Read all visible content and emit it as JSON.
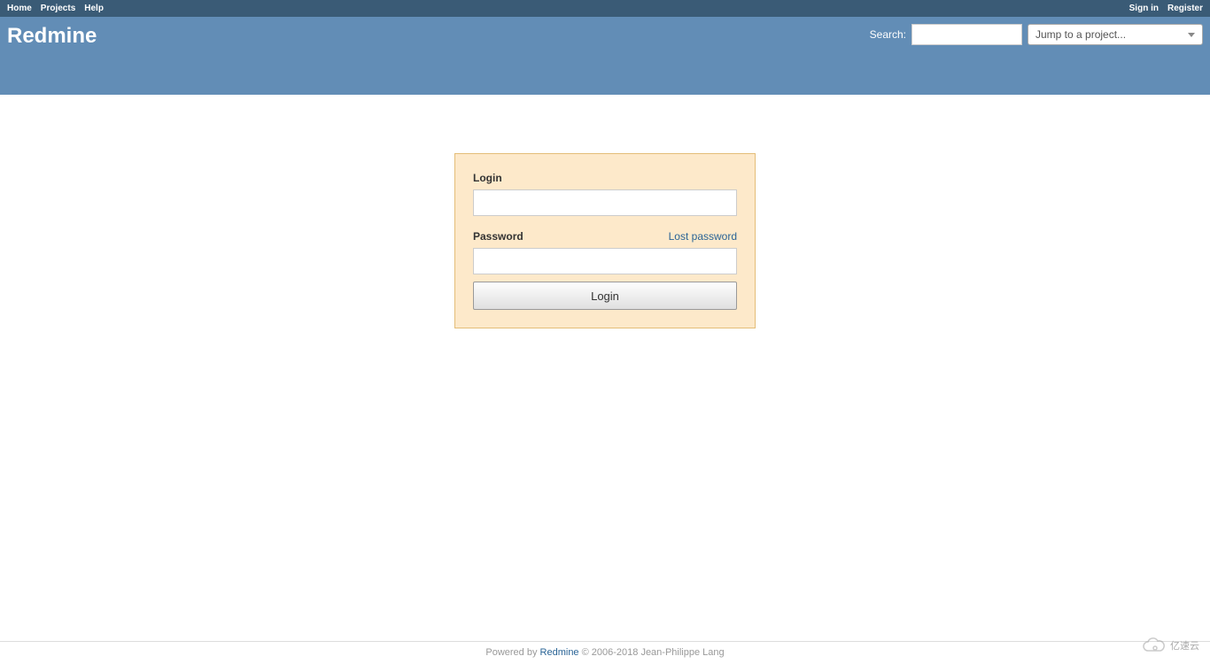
{
  "top_menu": {
    "left": [
      "Home",
      "Projects",
      "Help"
    ],
    "right": [
      "Sign in",
      "Register"
    ]
  },
  "header": {
    "title": "Redmine",
    "search_label": "Search:",
    "project_dropdown": "Jump to a project..."
  },
  "login": {
    "login_label": "Login",
    "password_label": "Password",
    "lost_password": "Lost password",
    "submit": "Login"
  },
  "footer": {
    "powered": "Powered by ",
    "link": "Redmine",
    "copyright": " © 2006-2018 Jean-Philippe Lang"
  },
  "watermark": "亿速云"
}
